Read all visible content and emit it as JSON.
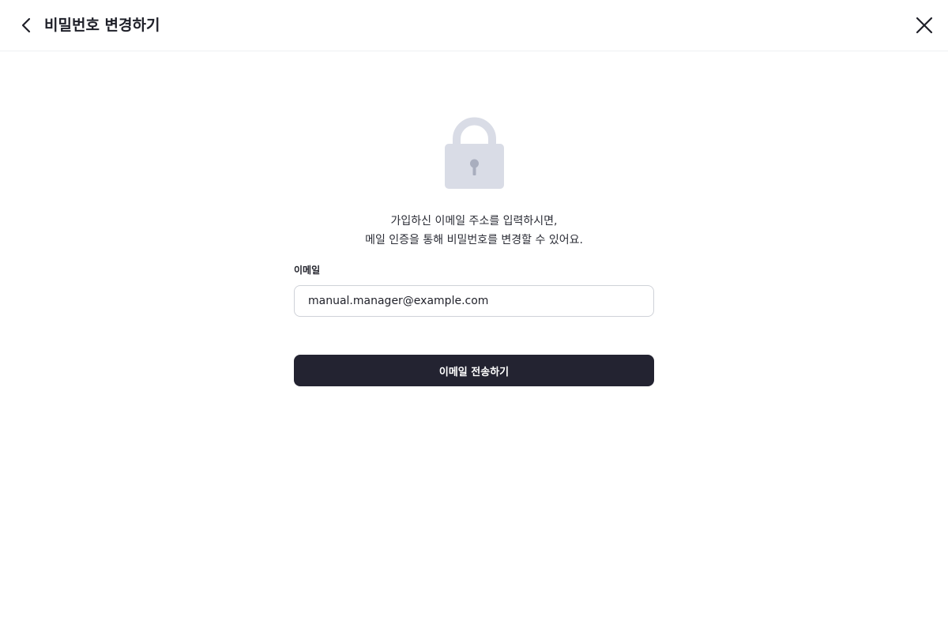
{
  "header": {
    "title": "비밀번호 변경하기",
    "back_icon": "chevron-left-icon",
    "close_icon": "close-icon"
  },
  "hero": {
    "icon": "lock-icon",
    "icon_color": "#d9dce6"
  },
  "description": {
    "line1": "가입하신 이메일 주소를 입력하시면,",
    "line2": "메일 인증을 통해 비밀번호를 변경할 수 있어요."
  },
  "form": {
    "email_label": "이메일",
    "email_value": "manual.manager@example.com",
    "submit_label": "이메일 전송하기"
  },
  "colors": {
    "primary_button": "#232331",
    "text": "#1f2029"
  }
}
